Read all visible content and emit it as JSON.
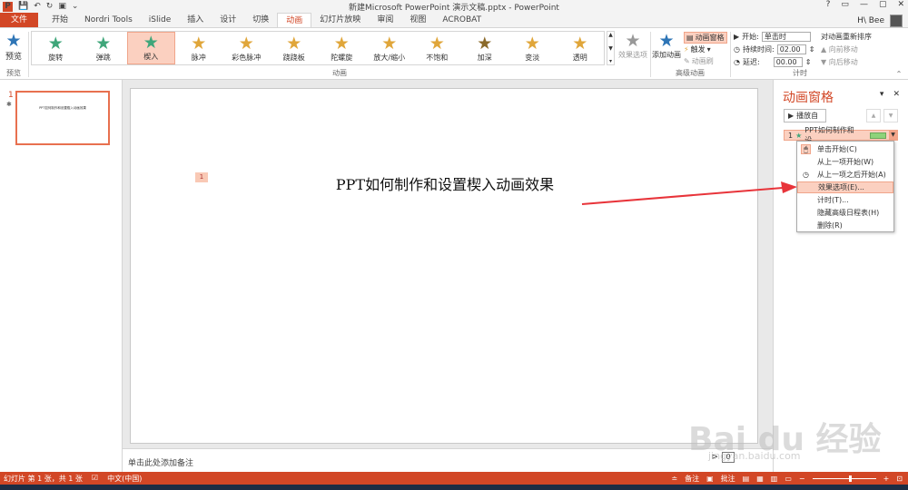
{
  "window": {
    "title": "新建Microsoft PowerPoint 演示文稿.pptx - PowerPoint",
    "controls": [
      "?",
      "▭",
      "—",
      "▢",
      "✕"
    ]
  },
  "user": {
    "name": "H\\ Bee"
  },
  "tabs": [
    "文件",
    "开始",
    "Nordri Tools",
    "iSlide",
    "插入",
    "设计",
    "切换",
    "动画",
    "幻灯片放映",
    "审阅",
    "视图",
    "ACROBAT"
  ],
  "ribbon": {
    "preview": {
      "label": "预览",
      "group": "预览"
    },
    "gallery": {
      "group": "动画",
      "items": [
        {
          "label": "旋转",
          "color": "#3fa67a"
        },
        {
          "label": "弹跳",
          "color": "#3fa67a"
        },
        {
          "label": "楔入",
          "color": "#3fa67a"
        },
        {
          "label": "脉冲",
          "color": "#e0a63a"
        },
        {
          "label": "彩色脉冲",
          "color": "#e0a63a"
        },
        {
          "label": "跷跷板",
          "color": "#e0a63a"
        },
        {
          "label": "陀螺旋",
          "color": "#e0a63a"
        },
        {
          "label": "放大/缩小",
          "color": "#e0a63a"
        },
        {
          "label": "不饱和",
          "color": "#e0a63a"
        },
        {
          "label": "加深",
          "color": "#8b6a2a"
        },
        {
          "label": "变淡",
          "color": "#e0a63a"
        },
        {
          "label": "透明",
          "color": "#e0a63a"
        }
      ]
    },
    "effect_options": "效果选项",
    "advanced": {
      "group": "高级动画",
      "add_animation": "添加动画",
      "animation_pane": "动画窗格",
      "trigger": "触发",
      "animation_painter": "动画刷"
    },
    "timing": {
      "group": "计时",
      "start_label": "开始:",
      "start_value": "单击时",
      "duration_label": "持续时间:",
      "duration_value": "02.00",
      "delay_label": "延迟:",
      "delay_value": "00.00",
      "reorder_title": "对动画重新排序",
      "move_earlier": "向前移动",
      "move_later": "向后移动"
    }
  },
  "thumbnails": {
    "slide_number": "1",
    "slide_text": "PPT如何制作和设置楔入动画效果"
  },
  "slide": {
    "title": "PPT如何制作和设置楔入动画效果",
    "anim_tag": "1"
  },
  "notes": {
    "placeholder": "单击此处添加备注",
    "page_box": "0"
  },
  "pane": {
    "title": "动画窗格",
    "play_label": "播放自",
    "entry": {
      "num": "1",
      "label": "PPT如何制作和设..."
    }
  },
  "menu": {
    "items": [
      "单击开始(C)",
      "从上一项开始(W)",
      "从上一项之后开始(A)",
      "效果选项(E)...",
      "计时(T)...",
      "隐藏高级日程表(H)",
      "删除(R)"
    ]
  },
  "status": {
    "slide_info": "幻灯片 第 1 张，共 1 张",
    "language": "中文(中国)",
    "notes": "备注",
    "comments": "批注"
  },
  "watermark": {
    "main": "Bai du 经验",
    "sub": "jingyan.baidu.com"
  },
  "colors": {
    "accent": "#d24726",
    "selection": "#fbd0c0",
    "arrow": "#e8343a"
  }
}
